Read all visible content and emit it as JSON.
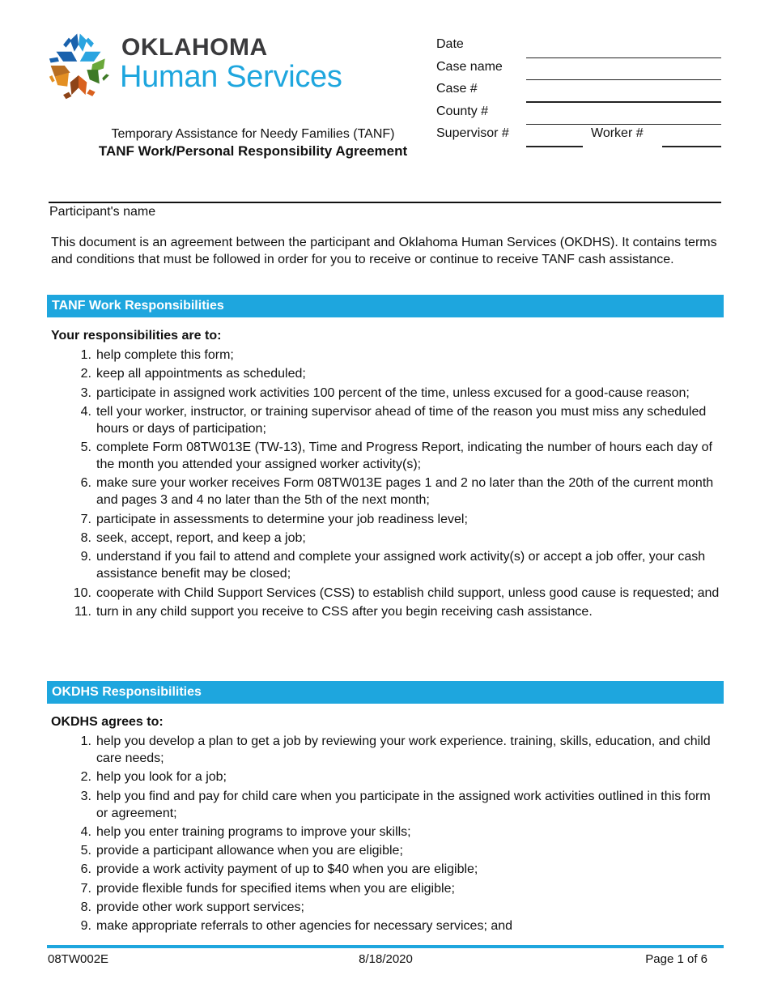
{
  "brand": {
    "line1": "OKLAHOMA",
    "line2": "Human Services",
    "colors": {
      "dark_text": "#3a3a3c",
      "accent_blue": "#1ea6de",
      "star_dark_blue": "#1a62ad",
      "star_light_blue": "#2aa4e0",
      "star_green": "#4b8a2e",
      "star_orange": "#d9611f",
      "star_brown": "#8e4418",
      "star_amber": "#e38f22"
    }
  },
  "header": {
    "subtitle": "Temporary Assistance for Needy Families (TANF)",
    "title": "TANF Work/Personal Responsibility Agreement"
  },
  "case_fields": {
    "date_label": "Date",
    "date_value": "",
    "case_name_label": "Case name",
    "case_name_value": "",
    "case_number_label": "Case #",
    "case_number_value": "",
    "county_number_label": "County #",
    "county_number_value": "",
    "supervisor_number_label": "Supervisor #",
    "supervisor_number_value": "",
    "worker_number_label": "Worker #",
    "worker_number_value": ""
  },
  "participant": {
    "label": "Participant's name",
    "value": ""
  },
  "intro": "This document is an agreement between the participant and Oklahoma Human Services (OKDHS). It contains terms and conditions that must be followed in order for you to receive or continue to receive TANF cash assistance.",
  "sections": [
    {
      "title": "TANF Work Responsibilities",
      "heading": "Your responsibilities are to:",
      "items": [
        {
          "num": "1.",
          "text": "help complete this form;"
        },
        {
          "num": "2.",
          "text": "keep all appointments as scheduled;"
        },
        {
          "num": "3.",
          "text": "participate in assigned work activities 100 percent of the time, unless excused for a good-cause reason;"
        },
        {
          "num": "4.",
          "text": "tell your worker, instructor, or training supervisor ahead of time of the reason you must miss any scheduled hours or days of participation;"
        },
        {
          "num": "5.",
          "text": "complete Form 08TW013E (TW-13), Time and Progress Report, indicating the number of hours each day of the month you attended your assigned worker activity(s);"
        },
        {
          "num": "6.",
          "text": "make sure your worker receives Form 08TW013E pages 1 and 2 no later than the 20th of the current month and pages 3 and 4 no later than the 5th of the next month;"
        },
        {
          "num": "7.",
          "text": "participate in assessments to determine your job readiness level;"
        },
        {
          "num": "8.",
          "text": "seek, accept, report, and keep a job;"
        },
        {
          "num": "9.",
          "text": "understand if you fail to attend and complete your assigned work activity(s) or accept a job offer, your cash assistance benefit may be closed;"
        },
        {
          "num": "10.",
          "text": "cooperate with Child Support Services (CSS) to establish child support, unless good cause is requested; and"
        },
        {
          "num": "11.",
          "text": "turn in any child support you receive to CSS after you begin receiving cash assistance."
        }
      ]
    },
    {
      "title": "OKDHS Responsibilities",
      "heading": "OKDHS agrees to:",
      "items": [
        {
          "num": "1.",
          "text": "help you develop a plan to get a job by reviewing your work experience. training, skills, education, and child care needs;"
        },
        {
          "num": "2.",
          "text": "help you look for a job;"
        },
        {
          "num": "3.",
          "text": "help you find and pay for child care when you participate in the assigned work activities outlined in this form or agreement;"
        },
        {
          "num": "4.",
          "text": "help you enter training programs to improve your skills;"
        },
        {
          "num": "5.",
          "text": "provide a participant allowance when you are eligible;"
        },
        {
          "num": "6.",
          "text": "provide a work activity payment of up to $40 when you are eligible;"
        },
        {
          "num": "7.",
          "text": "provide flexible funds for specified items when you are eligible;"
        },
        {
          "num": "8.",
          "text": "provide other work support services;"
        },
        {
          "num": "9.",
          "text": "make appropriate referrals to other agencies for necessary services; and"
        }
      ]
    }
  ],
  "footer": {
    "form_number": "08TW002E",
    "revision_date": "8/18/2020",
    "page_label": "Page 1 of 6"
  }
}
